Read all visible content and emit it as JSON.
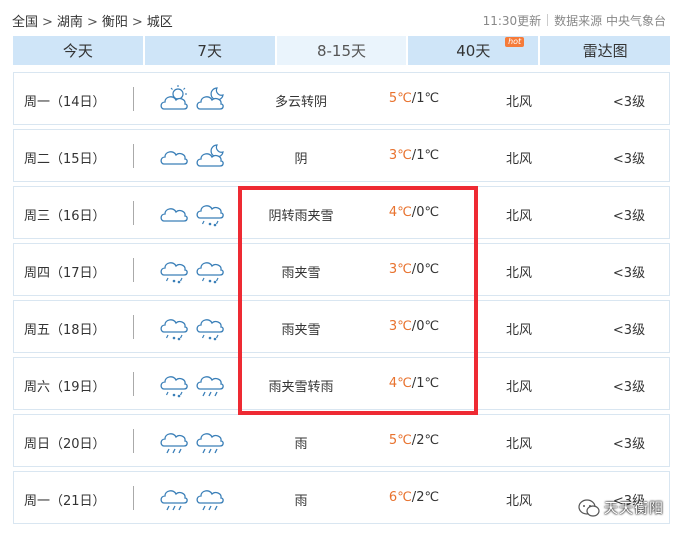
{
  "breadcrumb": {
    "items": [
      "全国",
      "湖南",
      "衡阳",
      "城区"
    ],
    "separator": ">"
  },
  "meta": {
    "update_time": "11:30更新",
    "source": "数据来源 中央气象台"
  },
  "tabs": [
    {
      "label": "今天",
      "active": false
    },
    {
      "label": "7天",
      "active": false
    },
    {
      "label": "8-15天",
      "active": true
    },
    {
      "label": "40天",
      "active": false,
      "badge": "hot"
    },
    {
      "label": "雷达图",
      "active": false
    }
  ],
  "forecast": [
    {
      "day": "周一（14日）",
      "icon_day": "partly-cloudy-sun-icon",
      "icon_night": "cloudy-night-icon",
      "condition": "多云转阴",
      "high": "5℃",
      "low": "1℃",
      "wind_dir": "北风",
      "wind_level": "<3级"
    },
    {
      "day": "周二（15日）",
      "icon_day": "overcast-icon",
      "icon_night": "cloudy-night-icon",
      "condition": "阴",
      "high": "3℃",
      "low": "1℃",
      "wind_dir": "北风",
      "wind_level": "<3级"
    },
    {
      "day": "周三（16日）",
      "icon_day": "overcast-icon",
      "icon_night": "sleet-icon",
      "condition": "阴转雨夹雪",
      "high": "4℃",
      "low": "0℃",
      "wind_dir": "北风",
      "wind_level": "<3级"
    },
    {
      "day": "周四（17日）",
      "icon_day": "sleet-icon",
      "icon_night": "sleet-icon",
      "condition": "雨夹雪",
      "high": "3℃",
      "low": "0℃",
      "wind_dir": "北风",
      "wind_level": "<3级"
    },
    {
      "day": "周五（18日）",
      "icon_day": "sleet-icon",
      "icon_night": "sleet-icon",
      "condition": "雨夹雪",
      "high": "3℃",
      "low": "0℃",
      "wind_dir": "北风",
      "wind_level": "<3级"
    },
    {
      "day": "周六（19日）",
      "icon_day": "sleet-icon",
      "icon_night": "rain-icon",
      "condition": "雨夹雪转雨",
      "high": "4℃",
      "low": "1℃",
      "wind_dir": "北风",
      "wind_level": "<3级"
    },
    {
      "day": "周日（20日）",
      "icon_day": "rain-icon",
      "icon_night": "rain-icon",
      "condition": "雨",
      "high": "5℃",
      "low": "2℃",
      "wind_dir": "北风",
      "wind_level": "<3级"
    },
    {
      "day": "周一（21日）",
      "icon_day": "rain-icon",
      "icon_night": "rain-icon",
      "condition": "雨",
      "high": "6℃",
      "low": "2℃",
      "wind_dir": "北风",
      "wind_level": "<3级"
    }
  ],
  "highlight": {
    "color": "#ee2a33"
  },
  "watermark": {
    "text": "天天衡阳",
    "icon": "wechat-official-account-icon"
  },
  "colors": {
    "high_temp": "#e8722e",
    "tab_bg": "#cfe5f8",
    "tab_active_bg": "#eaf4fc",
    "icon_stroke": "#3a7fb8",
    "row_border": "#d9e6f1"
  }
}
